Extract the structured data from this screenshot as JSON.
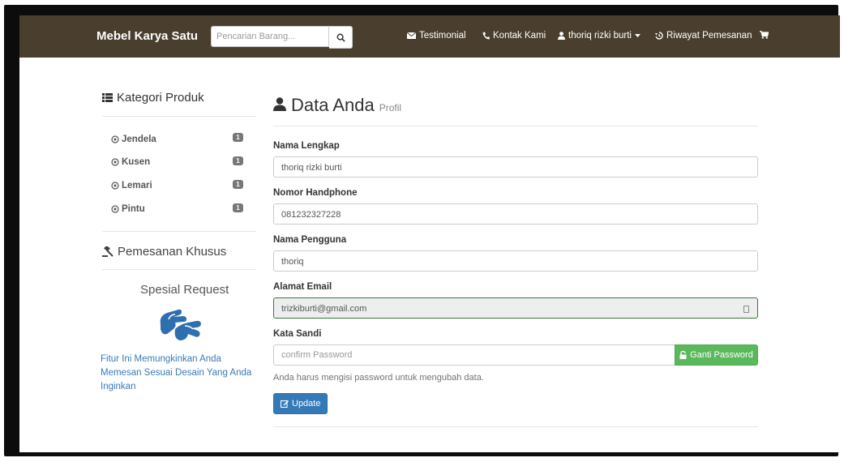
{
  "navbar": {
    "brand": "Mebel Karya Satu",
    "search_placeholder": "Pencarian Barang...",
    "testimonial": "Testimonial",
    "kontak": "Kontak Kami",
    "user": "thoriq rizki burti",
    "riwayat": "Riwayat Pemesanan",
    "bg_color": "#4a3f2e"
  },
  "sidebar": {
    "kategori_title": "Kategori Produk",
    "categories": [
      {
        "label": "Jendela",
        "count": "1"
      },
      {
        "label": "Kusen",
        "count": "1"
      },
      {
        "label": "Lemari",
        "count": "1"
      },
      {
        "label": "Pintu",
        "count": "1"
      }
    ],
    "pemesanan_title": "Pemesanan Khusus",
    "spesial_title": "Spesial Request",
    "fitur_text": "Fitur Ini Memungkinkan Anda Memesan Sesuai Desain Yang Anda Inginkan"
  },
  "form": {
    "title": "Data Anda",
    "subtitle": "Profil",
    "nama_label": "Nama Lengkap",
    "nama_value": "thoriq rizki burti",
    "hp_label": "Nomor Handphone",
    "hp_value": "081232327228",
    "username_label": "Nama Pengguna",
    "username_value": "thoriq",
    "email_label": "Alamat Email",
    "email_value": "trizkiburti@gmail.com",
    "password_label": "Kata Sandi",
    "password_placeholder": "confirm Password",
    "ganti_button": "Ganti Password",
    "help_text": "Anda harus mengisi password untuk mengubah data.",
    "update_button": "Update"
  }
}
